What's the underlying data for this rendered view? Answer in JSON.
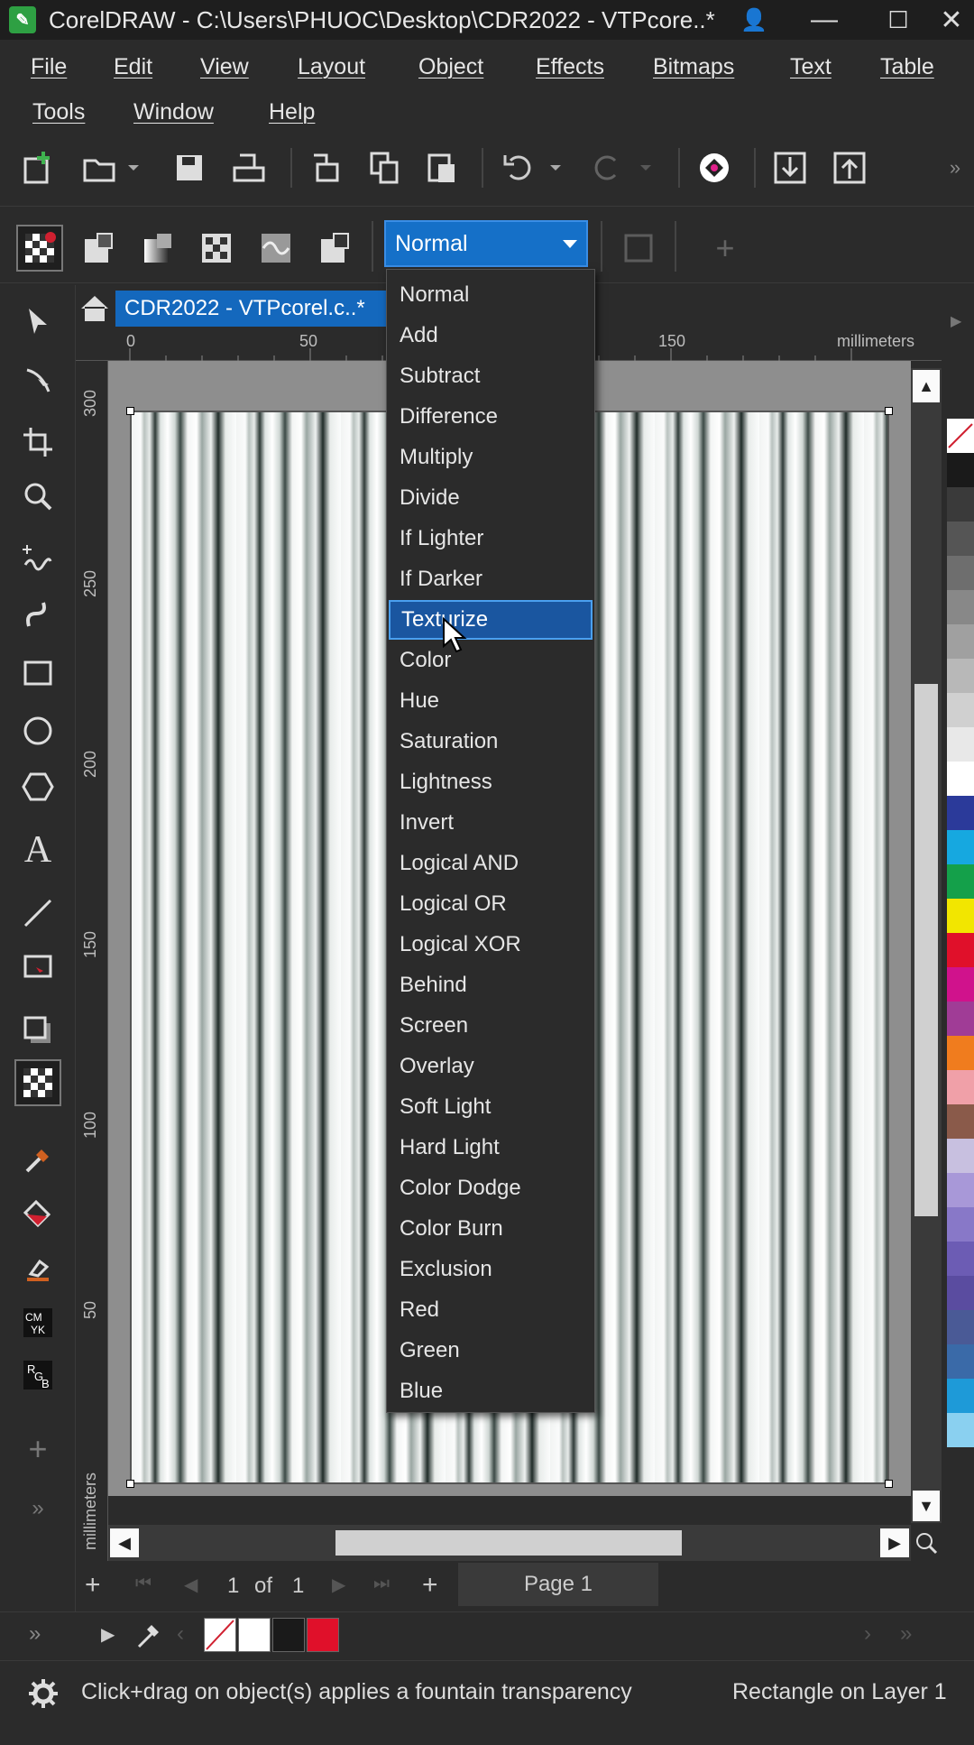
{
  "window": {
    "title": "CorelDRAW - C:\\Users\\PHUOC\\Desktop\\CDR2022 - VTPcore..*",
    "minimize": "—",
    "maximize": "☐",
    "close": "✕"
  },
  "menu": [
    "File",
    "Edit",
    "View",
    "Layout",
    "Object",
    "Effects",
    "Bitmaps",
    "Text",
    "Table",
    "Tools",
    "Window",
    "Help"
  ],
  "toolbar": {
    "blend_mode": "Normal"
  },
  "document": {
    "tab_label": "CDR2022 - VTPcorel.c..*"
  },
  "ruler": {
    "units": "millimeters",
    "h_ticks": [
      "0",
      "50",
      "150"
    ],
    "v_ticks": [
      "300",
      "250",
      "200",
      "150",
      "100",
      "50"
    ],
    "v_units": "millimeters"
  },
  "dropdown": {
    "options": [
      "Normal",
      "Add",
      "Subtract",
      "Difference",
      "Multiply",
      "Divide",
      "If Lighter",
      "If Darker",
      "Texturize",
      "Color",
      "Hue",
      "Saturation",
      "Lightness",
      "Invert",
      "Logical AND",
      "Logical OR",
      "Logical XOR",
      "Behind",
      "Screen",
      "Overlay",
      "Soft Light",
      "Hard Light",
      "Color Dodge",
      "Color Burn",
      "Exclusion",
      "Red",
      "Green",
      "Blue"
    ],
    "highlighted": "Texturize"
  },
  "pager": {
    "current": "1",
    "of_label": "of",
    "total": "1",
    "page_tab": "Page 1"
  },
  "status": {
    "hint": "Click+drag on object(s) applies a fountain transparency",
    "selection": "Rectangle on Layer 1"
  },
  "palette_colors": [
    "#ffffff",
    "#1a1a1a",
    "#3a3a3a",
    "#555555",
    "#6e6e6e",
    "#888888",
    "#a0a0a0",
    "#b8b8b8",
    "#d0d0d0",
    "#e8e8e8",
    "#ffffff",
    "#2b3a9a",
    "#16a8e0",
    "#14a04a",
    "#f2e600",
    "#e0102a",
    "#d0128c",
    "#a03c96",
    "#f07c1e",
    "#f0a0a8",
    "#8a5a4a",
    "#c8c0e0",
    "#a898d8",
    "#8878c8",
    "#6c5cb4",
    "#5a4ca0",
    "#4a5a96",
    "#3a6aa8",
    "#1e9ad8",
    "#8ad0f0"
  ],
  "colorbar": {
    "swatches": [
      "#ffffff",
      "#1a1a1a",
      "#e0102a"
    ]
  }
}
